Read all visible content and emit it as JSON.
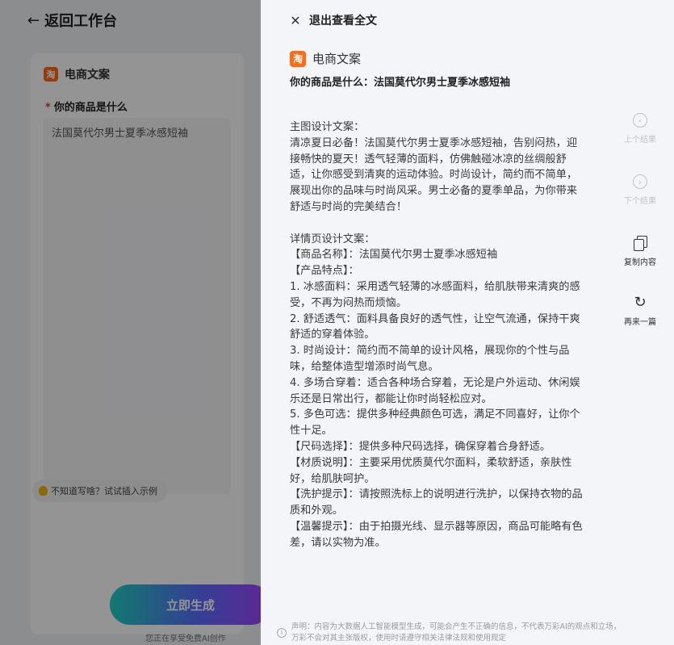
{
  "background": {
    "back_label": "返回工作台",
    "category_label": "电商文案",
    "field_label": "你的商品是什么",
    "field_value": "法国莫代尔男士夏季冰感短袖",
    "hint_text": "不知道写啥？试试插入示例",
    "generate_button": "立即生成",
    "footnote": "您正在享受免费AI创作"
  },
  "drawer": {
    "exit_label": "退出查看全文",
    "category_label": "电商文案",
    "question": "你的商品是什么：法国莫代尔男士夏季冰感短袖",
    "paragraphs": [
      "主图设计文案：",
      "清凉夏日必备！法国莫代尔男士夏季冰感短袖，告别闷热，迎接畅快的夏天！透气轻薄的面料，仿佛触碰冰凉的丝绸般舒适，让你感受到清爽的运动体验。时尚设计，简约而不简单，展现出你的品味与时尚风采。男士必备的夏季单品，为你带来舒适与时尚的完美结合！",
      "",
      "详情页设计文案：",
      "【商品名称】：法国莫代尔男士夏季冰感短袖",
      "【产品特点】：",
      "1. 冰感面料：采用透气轻薄的冰感面料，给肌肤带来清爽的感受，不再为闷热而烦恼。",
      "2. 舒适透气：面料具备良好的透气性，让空气流通，保持干爽舒适的穿着体验。",
      "3. 时尚设计：简约而不简单的设计风格，展现你的个性与品味，给整体造型增添时尚气息。",
      "4. 多场合穿着：适合各种场合穿着，无论是户外运动、休闲娱乐还是日常出行，都能让你时尚轻松应对。",
      "5. 多色可选：提供多种经典颜色可选，满足不同喜好，让你个性十足。",
      "【尺码选择】：提供多种尺码选择，确保穿着合身舒适。",
      "【材质说明】：主要采用优质莫代尔面料，柔软舒适，亲肤性好，给肌肤呵护。",
      "【洗护提示】：请按照洗标上的说明进行洗护，以保持衣物的品质和外观。",
      "【温馨提示】：由于拍摄光线、显示器等原因，商品可能略有色差，请以实物为准。"
    ],
    "disclaimer": "声明：内容为大数据人工智能模型生成，可能会产生不正确的信息，不代表万彩AI的观点和立场，万彩不会对其主张版权，使用时请遵守相关法律法规和使用规定"
  },
  "side_actions": {
    "prev": "上个结果",
    "next": "下个结果",
    "copy": "复制内容",
    "again": "再来一篇"
  },
  "colors": {
    "brand_orange": "#ff6a13",
    "drawer_bg": "#f4f5f8",
    "generate_gradient_start": "#1fd1c1",
    "generate_gradient_end": "#a443ff"
  }
}
